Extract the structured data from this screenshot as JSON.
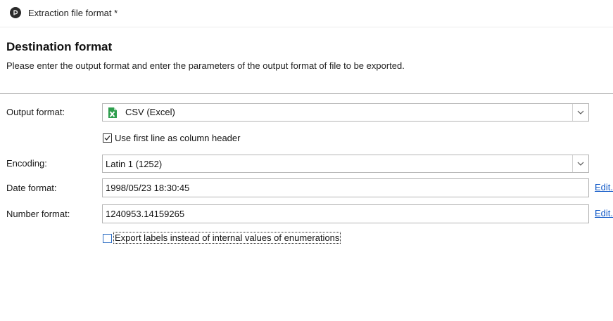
{
  "window": {
    "title": "Extraction file format *",
    "icon": "app-logo-icon"
  },
  "header": {
    "title": "Destination format",
    "description": "Please enter the output format and enter the parameters of the output format of file to be exported."
  },
  "form": {
    "output_format": {
      "label": "Output format:",
      "value": "CSV (Excel)",
      "icon": "excel-csv-icon",
      "icon_color": "#1e7145"
    },
    "first_line_header": {
      "label": "Use first line as column header",
      "checked": true
    },
    "encoding": {
      "label": "Encoding:",
      "value": "Latin 1 (1252)"
    },
    "date_format": {
      "label": "Date format:",
      "value": "1998/05/23 18:30:45",
      "edit_label": "Edit..."
    },
    "number_format": {
      "label": "Number format:",
      "value": "1240953.14159265",
      "edit_label": "Edit..."
    },
    "export_labels": {
      "label": "Export labels instead of internal values of enumerations",
      "checked": false
    }
  },
  "colors": {
    "link": "#0b55c6",
    "checkbox_focus": "#2f6fc4",
    "divider": "#a0a0a0"
  }
}
